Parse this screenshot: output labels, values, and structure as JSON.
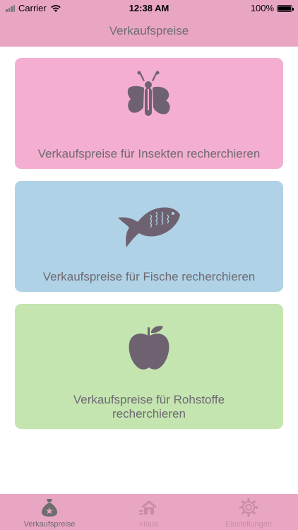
{
  "status_bar": {
    "carrier": "Carrier",
    "time": "12:38 AM",
    "battery": "100%"
  },
  "nav": {
    "title": "Verkaufspreise"
  },
  "cards": [
    {
      "label": "Verkaufspreise für Insekten recherchieren",
      "icon": "butterfly-icon",
      "color": "#f4aed0"
    },
    {
      "label": "Verkaufspreise für Fische recherchieren",
      "icon": "fish-icon",
      "color": "#b0d2e6"
    },
    {
      "label_line1": "Verkaufspreise für Rohstoffe",
      "label_line2": "recherchieren",
      "icon": "apple-icon",
      "color": "#c4e4b0"
    }
  ],
  "tabs": [
    {
      "label": "Verkaufspreise",
      "icon": "money-bag-icon",
      "active": true
    },
    {
      "label": "Haus",
      "icon": "house-icon",
      "active": false
    },
    {
      "label": "Einstellungen",
      "icon": "gear-icon",
      "active": false
    }
  ],
  "colors": {
    "bar": "#e9a6c2",
    "icon_dark": "#6e6270",
    "text": "#6e6a72"
  }
}
